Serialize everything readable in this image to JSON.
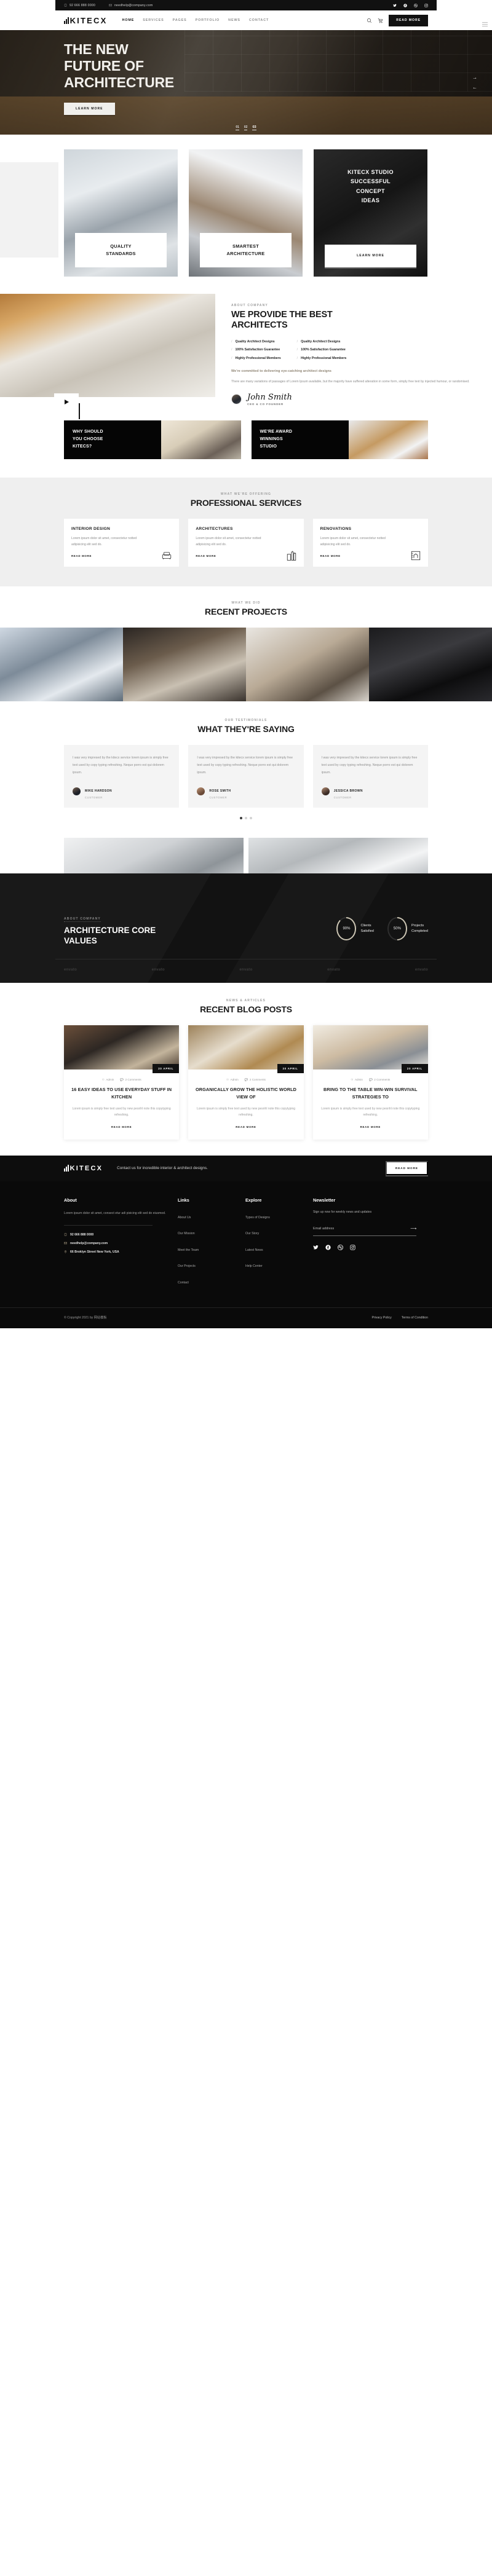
{
  "topbar": {
    "phone": "92 666 888 0000",
    "email": "needhelp@company.com",
    "socials": [
      "twitter-icon",
      "facebook-icon",
      "dribbble-icon",
      "instagram-icon"
    ]
  },
  "header": {
    "brand": "KITECX",
    "nav": [
      {
        "label": "HOME",
        "active": true
      },
      {
        "label": "SERVICES",
        "active": false
      },
      {
        "label": "PAGES",
        "active": false
      },
      {
        "label": "PORTFOLIO",
        "active": false
      },
      {
        "label": "NEWS",
        "active": false
      },
      {
        "label": "CONTACT",
        "active": false
      }
    ],
    "search_icon": "search-icon",
    "cart_icon": "cart-icon",
    "cta": "READ MORE"
  },
  "hero": {
    "line1": "THE NEW",
    "line2": "FUTURE OF",
    "line3": "ARCHITECTURE",
    "button": "LEARN MORE",
    "slides": [
      "01",
      "02",
      "03"
    ],
    "active_slide": "03",
    "next_arrow": "→",
    "prev_arrow": "←"
  },
  "features": [
    {
      "title_line1": "QUALITY",
      "title_line2": "STANDARDS"
    },
    {
      "title_line1": "SMARTEST",
      "title_line2": "ARCHITECTURE"
    }
  ],
  "feature_dark": {
    "l1": "KITECX STUDIO",
    "l2": "SUCCESSFUL",
    "l3": "CONCEPT",
    "l4": "IDEAS",
    "button": "LEARN MORE"
  },
  "about": {
    "eyebrow": "ABOUT COMPANY",
    "title_l1": "WE PROVIDE THE BEST",
    "title_l2": "ARCHITECTS",
    "checks_left": [
      "Quality Architect Designs",
      "100% Satisfaction Guarantee",
      "Highly Professional Members"
    ],
    "checks_right": [
      "Quality Architect Designs",
      "100% Satisfaction Guarantee",
      "Highly Professional Members"
    ],
    "tagline": "We're committed to delivering eye-catching architect designs",
    "paragraph": "There are many variations of passages of Lorem Ipsum available, but the majority have suffered alteration in some form, simply free text by injected humour, or randomised.",
    "signature": "John Smith",
    "role": "CEO & CO FOUNDER",
    "play_icon": "play-icon"
  },
  "promos": [
    {
      "l1": "WHY SHOULD",
      "l2": "YOU CHOOSE",
      "l3": "KITECS?"
    },
    {
      "l1": "WE'RE AWARD",
      "l2": "WINNINGS",
      "l3": "STUDIO"
    }
  ],
  "services": {
    "eyebrow": "WHAT WE'RE OFFERING",
    "title": "PROFESSIONAL SERVICES",
    "items": [
      {
        "name": "INTERIOR DESIGN",
        "desc": "Lorem ipsum dolor sit amet, consectetur notted adipisicing elit sed do.",
        "more": "READ MORE",
        "icon": "sofa-icon"
      },
      {
        "name": "ARCHITECTURES",
        "desc": "Lorem ipsum dolor sit amet, consectetur notted adipisicing elit sed do.",
        "more": "READ MORE",
        "icon": "buildings-icon"
      },
      {
        "name": "RENOVATIONS",
        "desc": "Lorem ipsum dolor sit amet, consectetur notted adipisicing elit sed do.",
        "more": "READ MORE",
        "icon": "blueprint-icon"
      }
    ]
  },
  "projects": {
    "eyebrow": "WHAT WE DID",
    "title": "RECENT PROJECTS"
  },
  "testimonials": {
    "eyebrow": "OUR TESTIMONIALS",
    "title": "WHAT THEY'RE SAYING",
    "items": [
      {
        "quote": "I was very impresed by the kitecx service lorem ipsum is simply free text used by copy typing refreshing. Neque porro est qui dolorem ipsum.",
        "name": "MIKE HARDSON",
        "role": "CUSTOMER"
      },
      {
        "quote": "I was very impresed by the kitecx service lorem ipsum is simply free text used by copy typing refreshing. Neque porro est qui dolorem ipsum.",
        "name": "ROSE SMITH",
        "role": "CUSTOMER"
      },
      {
        "quote": "I was very impresed by the kitecx service lorem ipsum is simply free text used by copy typing refreshing. Neque porro est qui dolorem ipsum.",
        "name": "JESSICA BROWN",
        "role": "CUSTOMER"
      }
    ]
  },
  "core": {
    "eyebrow": "ABOUT COMPANY",
    "title_l1": "ARCHITECTURE CORE",
    "title_l2": "VALUES",
    "stats": [
      {
        "value": "90%",
        "label_l1": "Clients",
        "label_l2": "Satisfied",
        "percent": 90
      },
      {
        "value": "50%",
        "label_l1": "Projects",
        "label_l2": "Completed",
        "percent": 50
      }
    ],
    "brands": [
      "envato",
      "envato",
      "envato",
      "envato",
      "envato"
    ]
  },
  "blog": {
    "eyebrow": "NEWS & ARTICLES",
    "title": "RECENT BLOG POSTS",
    "posts": [
      {
        "date": "20 APRIL",
        "author": "Admin",
        "comments": "2 Comments",
        "title": "16 EASY IDEAS TO USE EVERYDAY STUFF IN KITCHEN",
        "excerpt": "Lorem ipsum is simply free text used by new pesnhl note this copytyping refreshing.",
        "more": "READ MORE"
      },
      {
        "date": "30 APRIL",
        "author": "Admin",
        "comments": "2 Comments",
        "title": "ORGANICALLY GROW THE HOLISTIC WORLD VIEW OF",
        "excerpt": "Lorem ipsum is simply free text used by new pesnhl note this copytyping refreshing.",
        "more": "READ MORE"
      },
      {
        "date": "20 APRIL",
        "author": "Admin",
        "comments": "2 Comments",
        "title": "BRING TO THE TABLE WIN-WIN SURVIVAL STRATEGIES TO",
        "excerpt": "Lorem ipsum is simply free text used by new pesnhl note this copytyping refreshing.",
        "more": "READ MORE"
      }
    ]
  },
  "cta": {
    "brand": "KITECX",
    "message": "Contact us for incredible interior & architect designs.",
    "button": "READ MORE"
  },
  "footer": {
    "about": {
      "heading": "About",
      "desc": "Lorem ipsum dolor sit amet, consect etur adi pisicing elit sed do eiusmod.",
      "phone": "92 666 888 0000",
      "email": "needhelp@company.com",
      "address": "66 Broklyn Street New York, USA"
    },
    "links": {
      "heading": "Links",
      "items": [
        "About Us",
        "Our Mission",
        "Meet the Team",
        "Our Projects",
        "Contact"
      ]
    },
    "explore": {
      "heading": "Explore",
      "items": [
        "Types of Designs",
        "Our Story",
        "Latest News",
        "Help Center"
      ]
    },
    "newsletter": {
      "heading": "Newsletter",
      "desc": "Sign up now for weekly news and updates",
      "placeholder": "Email address",
      "value": "",
      "submit_icon": "arrow-right-icon",
      "socials": [
        "twitter-icon",
        "facebook-icon",
        "dribbble-icon",
        "instagram-icon"
      ]
    },
    "bottom": {
      "copyright": "© Copyright 2021 by 网站模板",
      "links": [
        "Privacy Policy",
        "Terms of Condition"
      ]
    }
  }
}
